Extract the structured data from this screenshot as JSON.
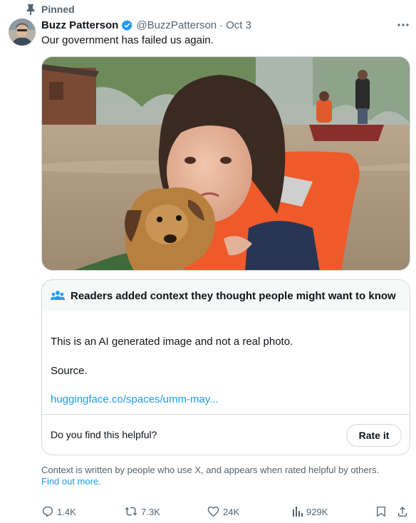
{
  "pinned": {
    "label": "Pinned"
  },
  "author": {
    "display_name": "Buzz Patterson",
    "handle": "@BuzzPatterson",
    "separator": "·",
    "date": "Oct 3"
  },
  "tweet": {
    "text": "Our government has failed us again."
  },
  "community_note": {
    "title": "Readers added context they thought people might want to know",
    "body": "This is an AI generated image and not a real photo.",
    "source_label": "Source.",
    "link_text": "huggingface.co/spaces/umm-may...",
    "helpful_question": "Do you find this helpful?",
    "rate_button": "Rate it"
  },
  "context_footer": {
    "text": "Context is written by people who use X, and appears when rated helpful by others.",
    "link": "Find out more",
    "period": "."
  },
  "actions": {
    "replies": "1.4K",
    "reposts": "7.3K",
    "likes": "24K",
    "views": "929K"
  },
  "icons": {
    "pin": "pin-icon",
    "verified": "verified-badge-icon",
    "more": "more-options-icon",
    "people": "people-group-icon",
    "reply": "reply-icon",
    "repost": "repost-icon",
    "like": "heart-icon",
    "views": "views-chart-icon",
    "bookmark": "bookmark-icon",
    "share": "share-icon"
  },
  "colors": {
    "text_primary": "#0f1419",
    "text_secondary": "#536471",
    "accent_blue": "#1d9bf0",
    "border": "#cfd9de",
    "note_header_bg": "#f7f9f9"
  }
}
